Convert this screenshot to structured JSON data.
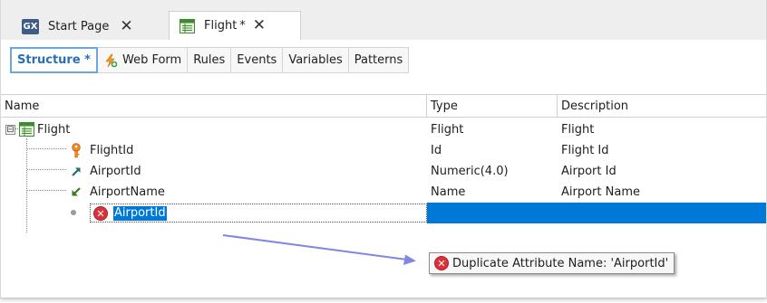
{
  "tabs": {
    "start_page": {
      "logo": "GX",
      "label": "Start Page",
      "close": "✕"
    },
    "flight": {
      "label": "Flight",
      "modified": "*",
      "close": "✕"
    }
  },
  "designer_tabs": [
    {
      "label": "Structure *",
      "active": true
    },
    {
      "label": "Web Form",
      "icon": "web-form-icon"
    },
    {
      "label": "Rules"
    },
    {
      "label": "Events"
    },
    {
      "label": "Variables"
    },
    {
      "label": "Patterns"
    }
  ],
  "grid": {
    "columns": {
      "name": "Name",
      "type": "Type",
      "description": "Description"
    },
    "rows": [
      {
        "name": "Flight",
        "type": "Flight",
        "description": "Flight",
        "icon": "transaction-icon",
        "expander": "⊟"
      },
      {
        "name": "FlightId",
        "type": "Id",
        "description": "Flight Id",
        "icon": "key-icon"
      },
      {
        "name": "AirportId",
        "type": "Numeric(4.0)",
        "description": "Airport Id",
        "icon": "foreign-key-arrow-icon"
      },
      {
        "name": "AirportName",
        "type": "Name",
        "description": "Airport Name",
        "icon": "inferred-arrow-icon"
      },
      {
        "name": "AirportId",
        "type": "",
        "description": "",
        "icon": "error-icon",
        "editing": true
      }
    ]
  },
  "tooltip": {
    "text": "Duplicate Attribute Name: 'AirportId'",
    "icon": "error-icon"
  },
  "colors": {
    "selection": "#0078d7",
    "active_tab": "#2a6fb4",
    "error": "#d9323a",
    "key": "#e8751a",
    "arrow": "#7f87e3"
  }
}
